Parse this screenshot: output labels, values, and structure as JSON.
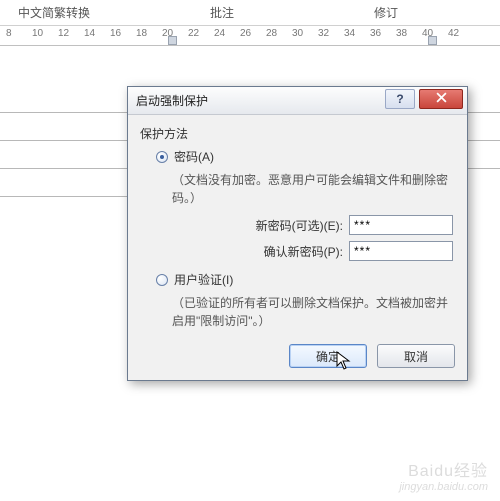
{
  "ribbon": {
    "group1": "中文简繁转换",
    "group2": "批注",
    "group3": "修订"
  },
  "ruler": {
    "ticks": [
      "8",
      "10",
      "12",
      "14",
      "16",
      "18",
      "20",
      "22",
      "24",
      "26",
      "28",
      "30",
      "32",
      "34",
      "36",
      "38",
      "40",
      "42"
    ]
  },
  "dialog": {
    "title": "启动强制保护",
    "group_label": "保护方法",
    "radio_password_label": "密码(A)",
    "password_desc": "（文档没有加密。恶意用户可能会编辑文件和删除密码。）",
    "new_password_label": "新密码(可选)(E):",
    "confirm_password_label": "确认新密码(P):",
    "new_password_value": "***",
    "confirm_password_value": "***",
    "radio_userauth_label": "用户验证(I)",
    "userauth_desc": "（已验证的所有者可以删除文档保护。文档被加密并启用\"限制访问\"。）",
    "ok_label": "确定",
    "cancel_label": "取消",
    "help_symbol": "?"
  },
  "watermark": {
    "line1": "Baidu经验",
    "line2": "jingyan.baidu.com"
  }
}
